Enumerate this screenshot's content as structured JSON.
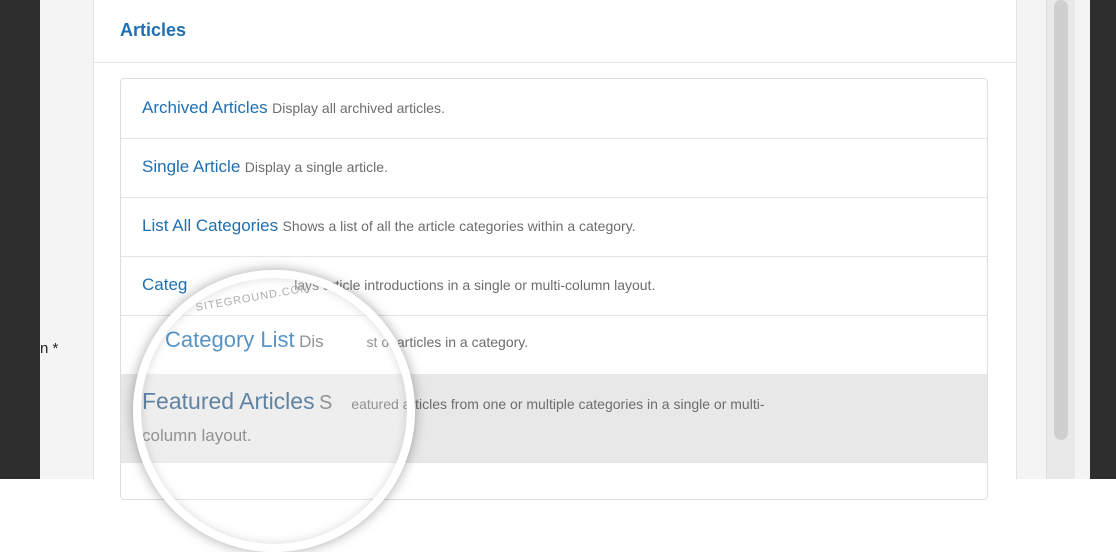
{
  "background": {
    "field_label": "n *"
  },
  "panel": {
    "title": "Articles",
    "items": [
      {
        "title": "Archived Articles",
        "desc": "Display all archived articles."
      },
      {
        "title": "Single Article",
        "desc": "Display a single article."
      },
      {
        "title": "List All Categories",
        "desc": "Shows a list of all the article categories within a category."
      },
      {
        "title": "Categ",
        "desc": "lays article introductions in a single or multi-column layout."
      },
      {
        "title": "Category List",
        "desc": "Dis",
        "desc_rest": "st of articles in a category."
      },
      {
        "title": "Featured Articles",
        "desc": "S",
        "desc_rest": "eatured articles from one or multiple categories in a single or multi-",
        "desc_line2": "column layout."
      }
    ]
  },
  "magnifier": {
    "watermark": "SITEGROUND.COM"
  }
}
